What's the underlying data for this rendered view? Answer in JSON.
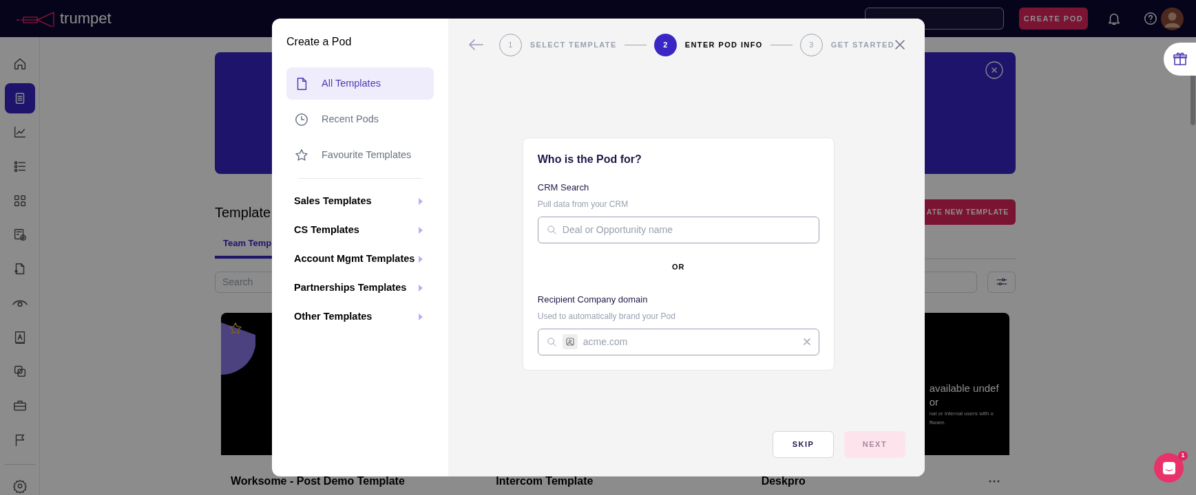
{
  "header": {
    "logo": "trumpet",
    "create_button": "CREATE POD"
  },
  "sidebar": {
    "items": [
      {
        "selected": false
      },
      {
        "selected": true
      },
      {
        "selected": false
      },
      {
        "selected": false
      },
      {
        "selected": false
      },
      {
        "selected": false
      },
      {
        "selected": false
      },
      {
        "selected": false
      },
      {
        "selected": false
      },
      {
        "selected": false
      },
      {
        "selected": false
      },
      {
        "selected": false
      }
    ]
  },
  "page": {
    "heading": "Template",
    "create_button": "ATE NEW TEMPLATE",
    "tabs": [
      {
        "label": "Team Temp",
        "selected": true
      }
    ],
    "search_placeholder": "Search",
    "cards": [
      {
        "title": "Worksome - Post Demo Template",
        "kind": "shape"
      },
      {
        "title": "Intercom Template",
        "kind": "plain"
      },
      {
        "title": "Deskpro",
        "kind": "text",
        "preview_lines": [
          "available undef",
          "or",
          "nal or internal users with o",
          "ftware."
        ]
      }
    ]
  },
  "modal": {
    "title": "Create a Pod",
    "nav": [
      {
        "label": "All Templates",
        "selected": true
      },
      {
        "label": "Recent Pods",
        "selected": false
      },
      {
        "label": "Favourite Templates",
        "selected": false
      }
    ],
    "categories": [
      "Sales Templates",
      "CS Templates",
      "Account Mgmt Templates",
      "Partnerships Templates",
      "Other Templates"
    ],
    "steps": [
      {
        "number": "1",
        "label": "SELECT TEMPLATE",
        "selected": false
      },
      {
        "number": "2",
        "label": "ENTER POD INFO",
        "selected": true
      },
      {
        "number": "3",
        "label": "GET STARTED",
        "selected": false
      }
    ],
    "form": {
      "title": "Who is the Pod for?",
      "separator": "OR",
      "fields": [
        {
          "label": "CRM Search",
          "hint": "Pull data from your CRM",
          "placeholder": "Deal or Opportunity name",
          "kind": "search"
        },
        {
          "label": "Recipient Company domain",
          "hint": "Used to automatically brand your Pod",
          "placeholder": "acme.com",
          "kind": "domain"
        }
      ]
    },
    "buttons": [
      {
        "label": "SKIP",
        "disabled": false
      },
      {
        "label": "NEXT",
        "disabled": true
      }
    ]
  },
  "chat": {
    "badge": "1"
  }
}
